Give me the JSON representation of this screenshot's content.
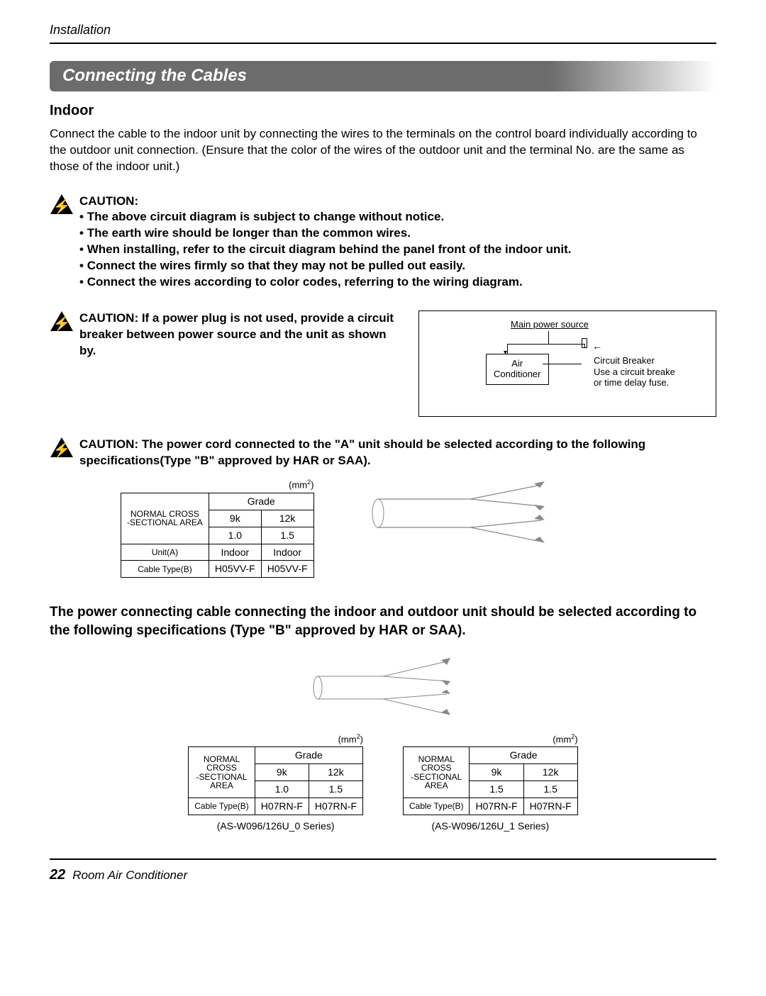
{
  "header": {
    "section": "Installation"
  },
  "banner": "Connecting the Cables",
  "indoor": {
    "heading": "Indoor",
    "paragraph": "Connect the cable to the indoor unit by connecting the wires to the terminals on the control board individually according to the outdoor unit connection. (Ensure that the color of the wires of the outdoor unit and the terminal No. are the same as those of the indoor unit.)"
  },
  "caution1": {
    "title": "CAUTION:",
    "items": [
      "The above circuit diagram is subject to change without notice.",
      "The earth wire should be longer than the common wires.",
      "When installing, refer to the circuit diagram behind the panel front of the indoor unit.",
      "Connect the wires firmly so that they may not be pulled out easily.",
      "Connect the wires according to color codes, referring to the wiring diagram."
    ]
  },
  "caution2": {
    "text": "CAUTION: If a power plug is not used, provide a circuit breaker between power source and the unit as shown by."
  },
  "diagram": {
    "main_power": "Main power source",
    "ac_line1": "Air",
    "ac_line2": "Conditioner",
    "breaker_line1": "Circuit Breaker",
    "breaker_line2": "Use a circuit breake",
    "breaker_line3": "or time delay fuse."
  },
  "caution3": {
    "text": "CAUTION: The power cord connected to the \"A\" unit should be selected according to the following specifications(Type \"B\" approved by HAR or SAA)."
  },
  "unit_mm2": "(mm²)",
  "table1": {
    "row1_label_l1": "NORMAL CROSS",
    "row1_label_l2": "-SECTIONAL AREA",
    "grade_header": "Grade",
    "c1": "9k",
    "c2": "12k",
    "v1": "1.0",
    "v2": "1.5",
    "unit_row_label": "Unit(A)",
    "unit_v1": "Indoor",
    "unit_v2": "Indoor",
    "cable_row_label": "Cable Type(B)",
    "cable_v1": "H05VV-F",
    "cable_v2": "H05VV-F"
  },
  "middle_bold": "The power connecting cable connecting the indoor and outdoor unit should be selected according to the following specifications (Type \"B\" approved by HAR or SAA).",
  "table2": {
    "row_label_l1": "NORMAL",
    "row_label_l2": "CROSS",
    "row_label_l3": "-SECTIONAL",
    "row_label_l4": "AREA",
    "grade_header": "Grade",
    "c1": "9k",
    "c2": "12k",
    "v1": "1.0",
    "v2": "1.5",
    "cable_row_label": "Cable Type(B)",
    "cable_v1": "H07RN-F",
    "cable_v2": "H07RN-F",
    "series": "(AS-W096/126U_0 Series)"
  },
  "table3": {
    "row_label_l1": "NORMAL",
    "row_label_l2": "CROSS",
    "row_label_l3": "-SECTIONAL",
    "row_label_l4": "AREA",
    "grade_header": "Grade",
    "c1": "9k",
    "c2": "12k",
    "v1": "1.5",
    "v2": "1.5",
    "cable_row_label": "Cable Type(B)",
    "cable_v1": "H07RN-F",
    "cable_v2": "H07RN-F",
    "series": "(AS-W096/126U_1 Series)"
  },
  "footer": {
    "page_num": "22",
    "title": "Room Air Conditioner"
  }
}
